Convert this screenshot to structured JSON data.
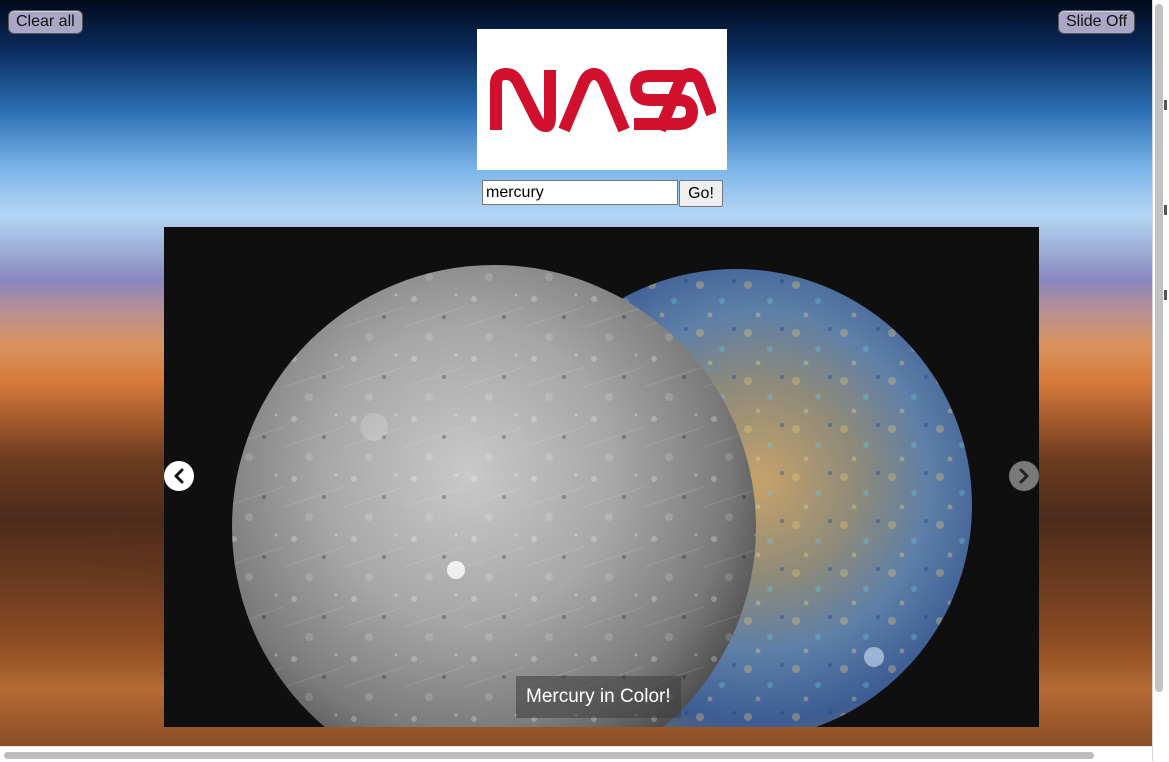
{
  "toolbar": {
    "clear_label": "Clear all",
    "slide_label": "Slide Off"
  },
  "logo": {
    "text": "NASA",
    "color": "#d0102c"
  },
  "search": {
    "value": "mercury",
    "go_label": "Go!"
  },
  "slideshow": {
    "caption": "Mercury in Color!",
    "prev_icon": "chevron-left-icon",
    "next_icon": "chevron-right-icon"
  },
  "colors": {
    "button_bg": "#a9a6c6",
    "slide_bg": "#0f0f0f"
  }
}
